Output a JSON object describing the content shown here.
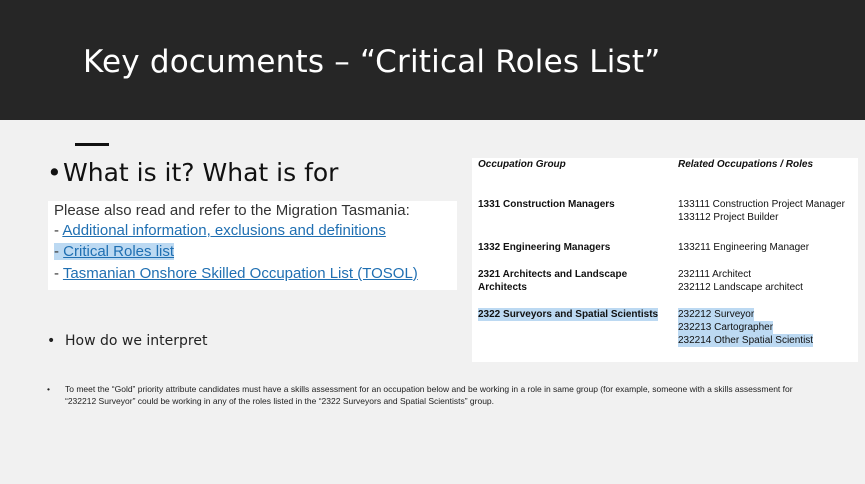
{
  "header": {
    "title": "Key documents – “Critical Roles List”"
  },
  "main": {
    "bullet_what": "What is it? What is for",
    "bullet_how": "How do we interpret",
    "bullet_glyph": "•",
    "reference": {
      "intro": "Please also read and refer to the Migration Tasmania:",
      "prefix": "- ",
      "links": [
        "Additional information, exclusions and definitions",
        "Critical Roles list",
        "Tasmanian Onshore Skilled Occupation List (TOSOL)"
      ]
    },
    "table": {
      "headers": [
        "Occupation Group",
        "Related Occupations / Roles"
      ],
      "rows": [
        {
          "group": "1331 Construction Managers",
          "roles": [
            "133111 Construction Project Manager",
            "133112 Project Builder"
          ]
        },
        {
          "group": "1332 Engineering Managers",
          "roles": [
            "133211 Engineering Manager"
          ]
        },
        {
          "group": [
            "2321 Architects and Landscape",
            "Architects"
          ],
          "roles": [
            "232111 Architect",
            "232112 Landscape architect"
          ]
        },
        {
          "group": "2322 Surveyors and Spatial Scientists",
          "roles": [
            "232212 Surveyor",
            "232213 Cartographer",
            "232214 Other Spatial Scientist"
          ]
        }
      ]
    },
    "footnote": "To meet the “Gold” priority attribute candidates must have a skills assessment for an occupation below and be working in a role in same group (for example, someone with a skills assessment for “232212 Surveyor” could be working in any of the roles listed in the “2322 Surveyors and Spatial Scientists” group."
  },
  "colors": {
    "title_bar": "#262626",
    "background": "#f1f1f1",
    "link": "#1f6fb2",
    "highlight": "#bcd9f2"
  }
}
